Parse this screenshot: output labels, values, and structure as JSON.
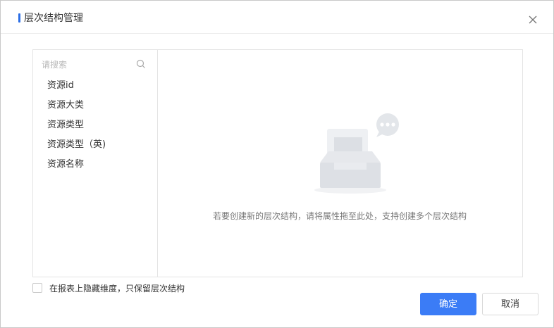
{
  "dialog": {
    "title": "层次结构管理",
    "close_icon": "close-icon"
  },
  "sidebar": {
    "search_placeholder": "请搜索",
    "search_icon": "search-icon",
    "items": [
      {
        "label": "资源id"
      },
      {
        "label": "资源大类"
      },
      {
        "label": "资源类型"
      },
      {
        "label": "资源类型（英)"
      },
      {
        "label": "资源名称"
      }
    ]
  },
  "main": {
    "empty_icon": "empty-inbox-chat-icon",
    "empty_message": "若要创建新的层次结构，请将属性拖至此处，支持创建多个层次结构"
  },
  "option": {
    "checked": false,
    "label": "在报表上隐藏维度，只保留层次结构"
  },
  "footer": {
    "confirm_label": "确定",
    "cancel_label": "取消"
  },
  "colors": {
    "accent": "#3b7cf6",
    "title_mark": "#2b6ee6",
    "border": "#e4e4e4"
  }
}
